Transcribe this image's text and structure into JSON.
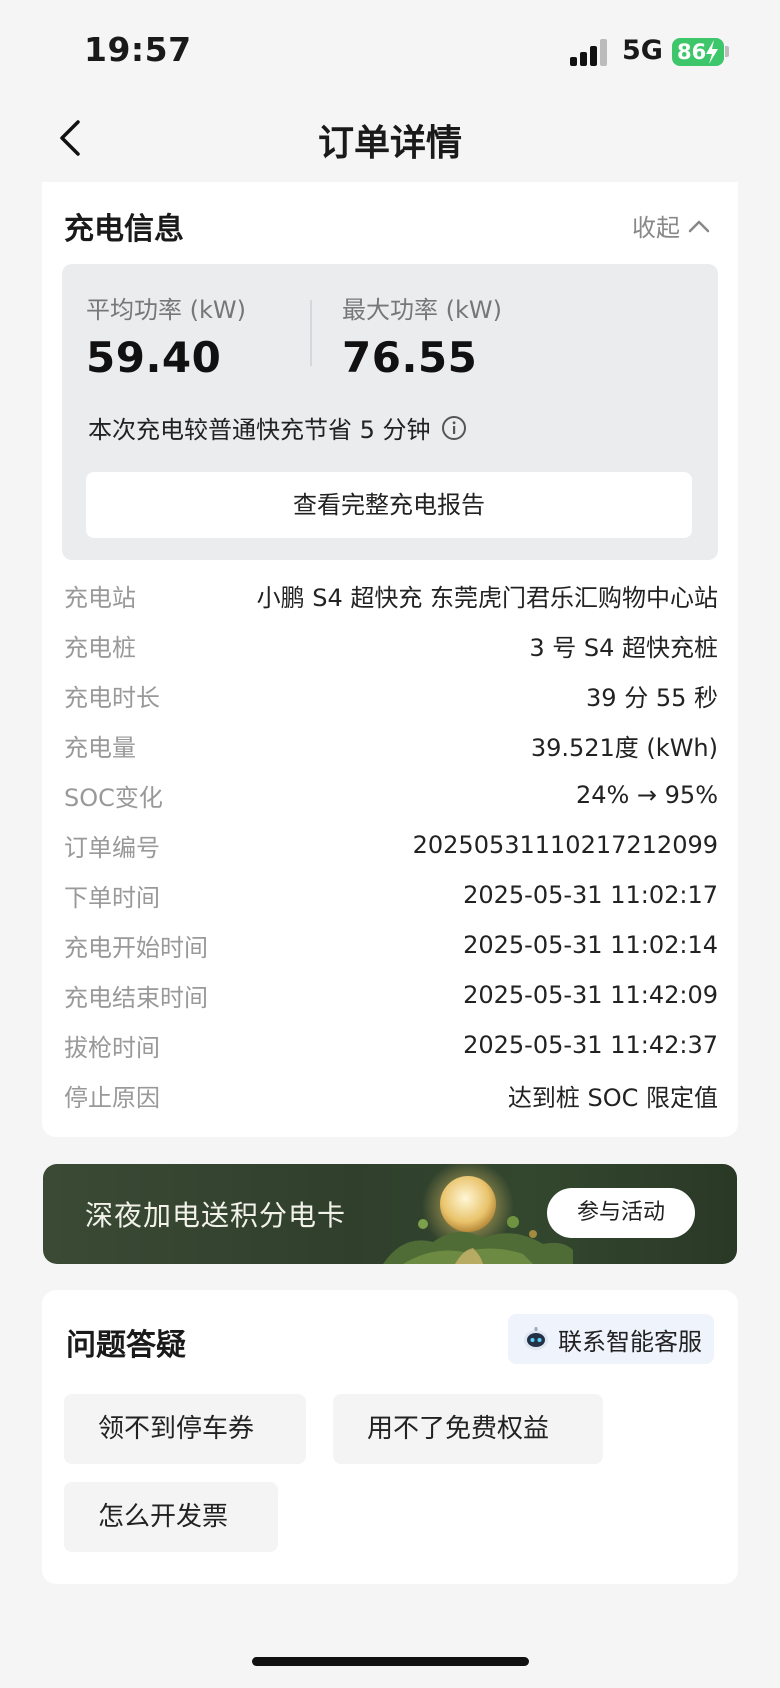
{
  "status_bar": {
    "time": "19:57",
    "network": "5G",
    "battery": "86"
  },
  "nav": {
    "title": "订单详情"
  },
  "charging_info": {
    "title": "充电信息",
    "collapse_label": "收起",
    "avg_power_label": "平均功率 (kW)",
    "avg_power_value": "59.40",
    "max_power_label": "最大功率 (kW)",
    "max_power_value": "76.55",
    "saving_text": "本次充电较普通快充节省 5 分钟",
    "report_button": "查看完整充电报告",
    "details": [
      {
        "label": "充电站",
        "value": "小鹏 S4 超快充 东莞虎门君乐汇购物中心站"
      },
      {
        "label": "充电桩",
        "value": "3 号 S4 超快充桩"
      },
      {
        "label": "充电时长",
        "value": "39 分 55 秒"
      },
      {
        "label": "充电量",
        "value": "39.521度 (kWh)"
      },
      {
        "label": "SOC变化",
        "value": "24% → 95%"
      },
      {
        "label": "订单编号",
        "value": "20250531110217212099"
      },
      {
        "label": "下单时间",
        "value": "2025-05-31 11:02:17"
      },
      {
        "label": "充电开始时间",
        "value": "2025-05-31 11:02:14"
      },
      {
        "label": "充电结束时间",
        "value": "2025-05-31 11:42:09"
      },
      {
        "label": "拔枪时间",
        "value": "2025-05-31 11:42:37"
      },
      {
        "label": "停止原因",
        "value": "达到桩 SOC 限定值"
      }
    ]
  },
  "banner": {
    "text": "深夜加电送积分电卡",
    "button": "参与活动"
  },
  "faq": {
    "title": "问题答疑",
    "contact_button": "联系智能客服",
    "chips": [
      "领不到停车券",
      "用不了免费权益",
      "怎么开发票"
    ]
  }
}
